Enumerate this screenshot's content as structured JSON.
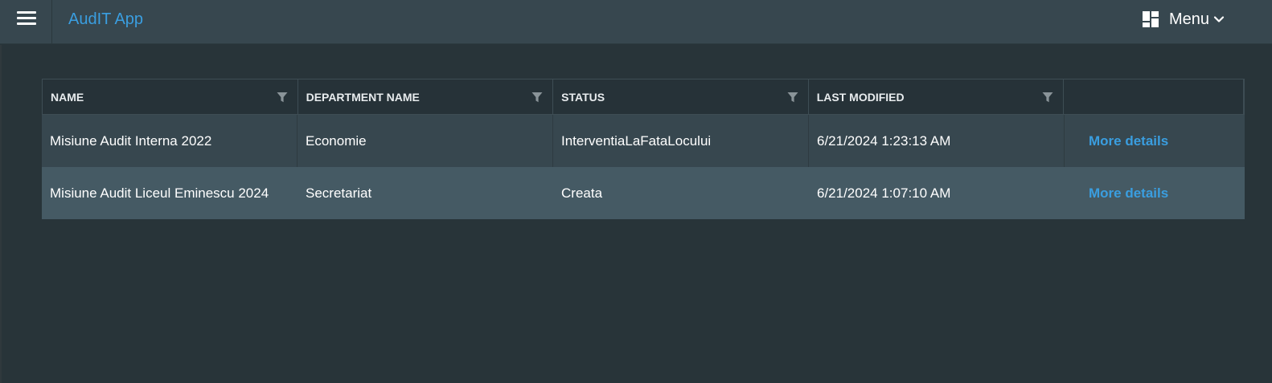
{
  "header": {
    "app_title": "AudIT App",
    "menu_label": "Menu",
    "icons": {
      "hamburger": "hamburger-icon",
      "menu": "dashboard-grid-icon",
      "menu_caret": "chevron-down-icon"
    }
  },
  "table": {
    "columns": [
      {
        "label": "NAME",
        "filter_icon": "filter-icon"
      },
      {
        "label": "DEPARTMENT NAME",
        "filter_icon": "filter-icon"
      },
      {
        "label": "STATUS",
        "filter_icon": "filter-icon"
      },
      {
        "label": "LAST MODIFIED",
        "filter_icon": "filter-icon"
      },
      {
        "label": ""
      }
    ],
    "rows": [
      {
        "name": "Misiune Audit Interna 2022",
        "department": "Economie",
        "status": "InterventiaLaFataLocului",
        "last_modified": "6/21/2024 1:23:13 AM",
        "action": "More details"
      },
      {
        "name": "Misiune Audit Liceul Eminescu 2024",
        "department": "Secretariat",
        "status": "Creata",
        "last_modified": "6/21/2024 1:07:10 AM",
        "action": "More details"
      }
    ]
  },
  "colors": {
    "accent": "#3a9ee0",
    "topbar": "#37474f",
    "background": "#283439",
    "row_odd": "#37474f",
    "row_even": "#455a64"
  }
}
